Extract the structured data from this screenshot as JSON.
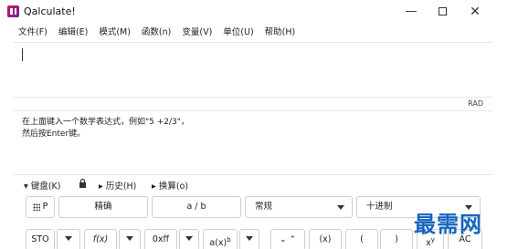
{
  "window": {
    "title": "Qalculate!",
    "minimize": "—",
    "close": "✕"
  },
  "menu": [
    "文件(F)",
    "编辑(E)",
    "模式(M)",
    "函数(n)",
    "变量(V)",
    "单位(U)",
    "帮助(H)"
  ],
  "status": {
    "angle_unit": "RAD"
  },
  "hint": {
    "line1": "在上面键入一个数学表达式，例如\"5 +2/3\"，",
    "line2": "然后按Enter键。"
  },
  "keypad_bar": {
    "keyboard": "键盘(K)",
    "history": "历史(H)",
    "convert": "换算(o)"
  },
  "keypad": {
    "p_label": "P",
    "exact": "精确",
    "fraction": "a / b",
    "mode_select": "常规",
    "base_select": "十进制",
    "sto": "STO",
    "fx": "f(x)",
    "hex": "0xff",
    "ax": "a(x)",
    "ax_sup": "b",
    "paren_x": "(x)",
    "lparen": "(",
    "rparen": ")",
    "xy": "x",
    "xy_sup": "y",
    "ac": "AC"
  },
  "watermark": "最需网"
}
